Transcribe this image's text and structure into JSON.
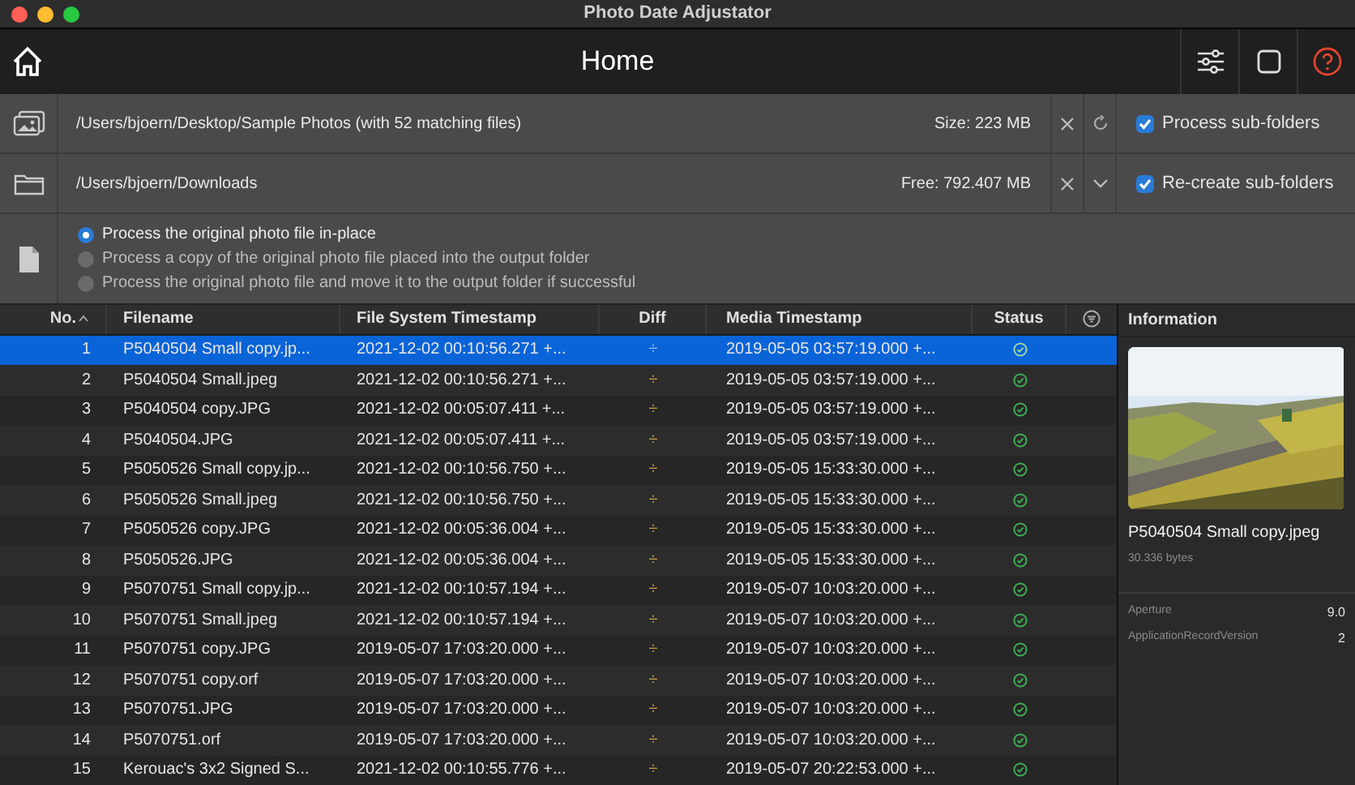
{
  "window": {
    "title": "Photo Date Adjustator"
  },
  "toolbar": {
    "title": "Home"
  },
  "source": {
    "path": "/Users/bjoern/Desktop/Sample Photos (with 52 matching files)",
    "size": "Size: 223 MB",
    "option": {
      "label": "Process sub-folders",
      "checked": true
    }
  },
  "output": {
    "path": "/Users/bjoern/Downloads",
    "free": "Free: 792.407 MB",
    "option": {
      "label": "Re-create sub-folders",
      "checked": true
    }
  },
  "modes": [
    {
      "label": "Process the original photo file in-place",
      "selected": true
    },
    {
      "label": "Process a copy of the original photo file placed into the output folder",
      "selected": false
    },
    {
      "label": "Process the original photo file and move it to the output folder if successful",
      "selected": false
    }
  ],
  "table": {
    "columns": [
      "No.",
      "Filename",
      "File System Timestamp",
      "Diff",
      "Media Timestamp",
      "Status"
    ],
    "rows": [
      {
        "no": "1",
        "filename": "P5040504 Small copy.jp...",
        "fs": "2021-12-02 00:10:56.271 +...",
        "diff": "÷",
        "media": "2019-05-05 03:57:19.000 +...",
        "selected": true
      },
      {
        "no": "2",
        "filename": "P5040504 Small.jpeg",
        "fs": "2021-12-02 00:10:56.271 +...",
        "diff": "÷",
        "media": "2019-05-05 03:57:19.000 +...",
        "selected": false
      },
      {
        "no": "3",
        "filename": "P5040504 copy.JPG",
        "fs": "2021-12-02 00:05:07.411 +...",
        "diff": "÷",
        "media": "2019-05-05 03:57:19.000 +...",
        "selected": false
      },
      {
        "no": "4",
        "filename": "P5040504.JPG",
        "fs": "2021-12-02 00:05:07.411 +...",
        "diff": "÷",
        "media": "2019-05-05 03:57:19.000 +...",
        "selected": false
      },
      {
        "no": "5",
        "filename": "P5050526 Small copy.jp...",
        "fs": "2021-12-02 00:10:56.750 +...",
        "diff": "÷",
        "media": "2019-05-05 15:33:30.000 +...",
        "selected": false
      },
      {
        "no": "6",
        "filename": "P5050526 Small.jpeg",
        "fs": "2021-12-02 00:10:56.750 +...",
        "diff": "÷",
        "media": "2019-05-05 15:33:30.000 +...",
        "selected": false
      },
      {
        "no": "7",
        "filename": "P5050526 copy.JPG",
        "fs": "2021-12-02 00:05:36.004 +...",
        "diff": "÷",
        "media": "2019-05-05 15:33:30.000 +...",
        "selected": false
      },
      {
        "no": "8",
        "filename": "P5050526.JPG",
        "fs": "2021-12-02 00:05:36.004 +...",
        "diff": "÷",
        "media": "2019-05-05 15:33:30.000 +...",
        "selected": false
      },
      {
        "no": "9",
        "filename": "P5070751 Small copy.jp...",
        "fs": "2021-12-02 00:10:57.194 +...",
        "diff": "÷",
        "media": "2019-05-07 10:03:20.000 +...",
        "selected": false
      },
      {
        "no": "10",
        "filename": "P5070751 Small.jpeg",
        "fs": "2021-12-02 00:10:57.194 +...",
        "diff": "÷",
        "media": "2019-05-07 10:03:20.000 +...",
        "selected": false
      },
      {
        "no": "11",
        "filename": "P5070751 copy.JPG",
        "fs": "2019-05-07 17:03:20.000 +...",
        "diff": "÷",
        "media": "2019-05-07 10:03:20.000 +...",
        "selected": false
      },
      {
        "no": "12",
        "filename": "P5070751 copy.orf",
        "fs": "2019-05-07 17:03:20.000 +...",
        "diff": "÷",
        "media": "2019-05-07 10:03:20.000 +...",
        "selected": false
      },
      {
        "no": "13",
        "filename": "P5070751.JPG",
        "fs": "2019-05-07 17:03:20.000 +...",
        "diff": "÷",
        "media": "2019-05-07 10:03:20.000 +...",
        "selected": false
      },
      {
        "no": "14",
        "filename": "P5070751.orf",
        "fs": "2019-05-07 17:03:20.000 +...",
        "diff": "÷",
        "media": "2019-05-07 10:03:20.000 +...",
        "selected": false
      },
      {
        "no": "15",
        "filename": "Kerouac's 3x2 Signed S...",
        "fs": "2021-12-02 00:10:55.776 +...",
        "diff": "÷",
        "media": "2019-05-07 20:22:53.000 +...",
        "selected": false
      }
    ]
  },
  "information": {
    "title": "Information",
    "filename": "P5040504 Small copy.jpeg",
    "size": "30.336 bytes",
    "properties": [
      {
        "name": "Aperture",
        "value": "9.0"
      },
      {
        "name": "ApplicationRecordVersion",
        "value": "2"
      }
    ]
  }
}
